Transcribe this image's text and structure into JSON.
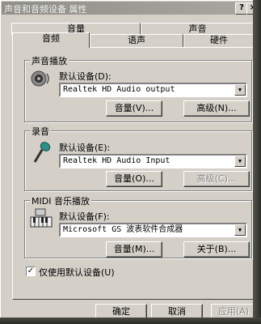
{
  "window": {
    "title": "声音和音频设备 属性"
  },
  "tabs": {
    "row1": [
      {
        "label": "音量"
      },
      {
        "label": "声音"
      }
    ],
    "row2": [
      {
        "label": "音频"
      },
      {
        "label": "语声"
      },
      {
        "label": "硬件"
      }
    ]
  },
  "playback": {
    "title": "声音播放",
    "default_label": "默认设备(D):",
    "device": "Realtek HD Audio output",
    "volume_btn": "音量(V)...",
    "advanced_btn": "高级(N)...",
    "icon": "speaker-icon"
  },
  "recording": {
    "title": "录音",
    "default_label": "默认设备(E):",
    "device": "Realtek HD Audio Input",
    "volume_btn": "音量(O)...",
    "advanced_btn": "高级(C)...",
    "icon": "microphone-icon"
  },
  "midi": {
    "title": "MIDI 音乐播放",
    "default_label": "默认设备(F):",
    "device": "Microsoft GS 波表软件合成器",
    "volume_btn": "音量(M)...",
    "about_btn": "关于(B)...",
    "icon": "keyboard-icon"
  },
  "use_default": {
    "label": "仅使用默认设备(U)",
    "checked": true
  },
  "buttons": {
    "ok": "确定",
    "cancel": "取消",
    "apply": "应用(A)"
  }
}
